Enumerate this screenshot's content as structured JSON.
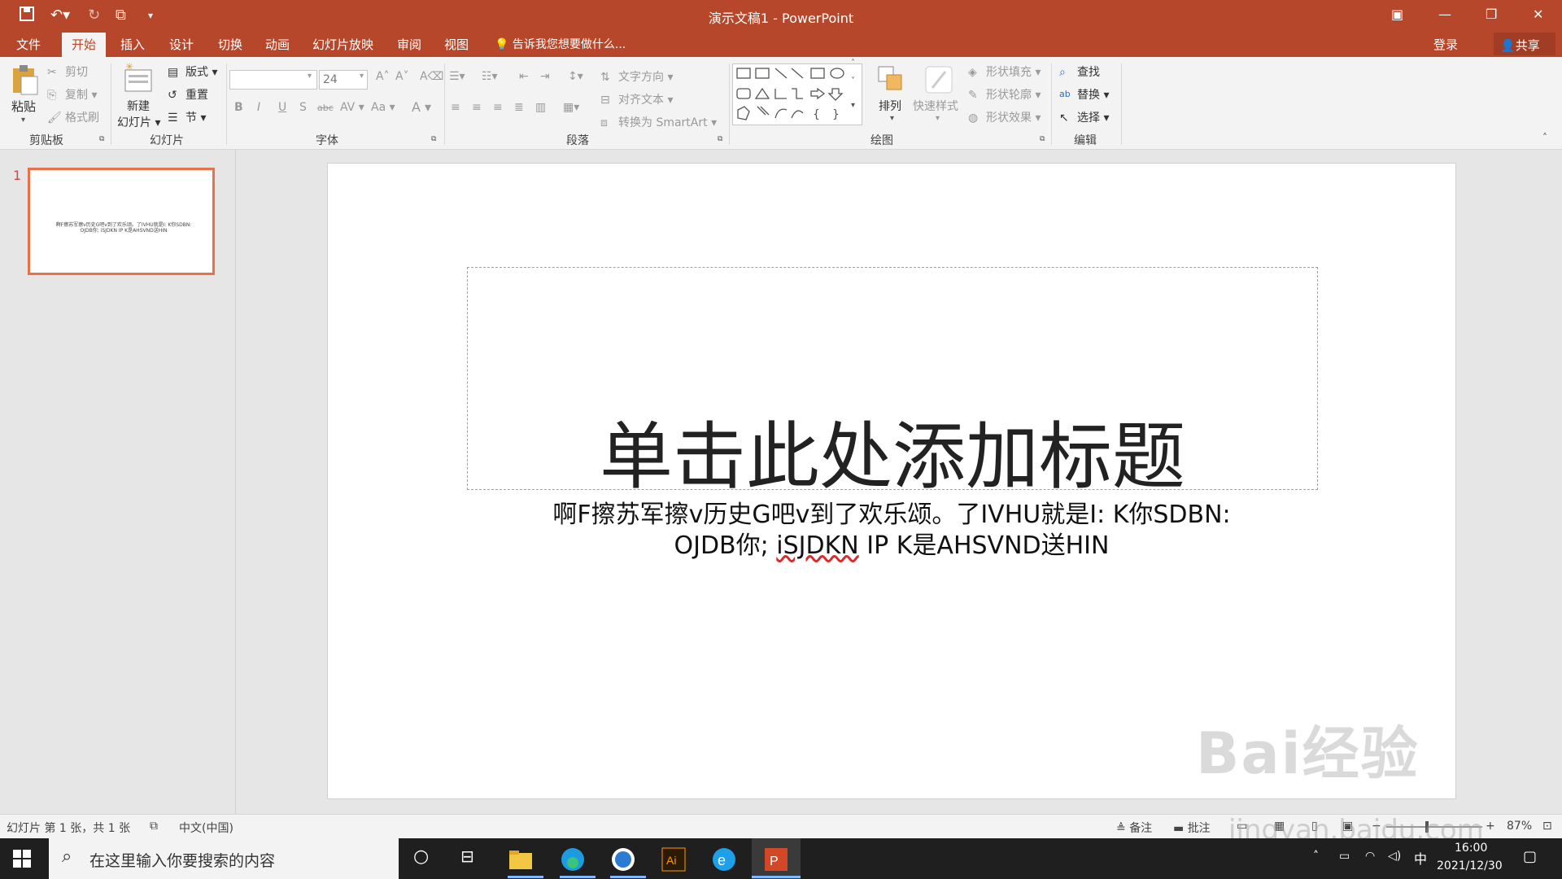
{
  "window": {
    "title": "演示文稿1 - PowerPoint"
  },
  "tabs": [
    {
      "label": "文件"
    },
    {
      "label": "开始"
    },
    {
      "label": "插入"
    },
    {
      "label": "设计"
    },
    {
      "label": "切换"
    },
    {
      "label": "动画"
    },
    {
      "label": "幻灯片放映"
    },
    {
      "label": "审阅"
    },
    {
      "label": "视图"
    }
  ],
  "tellme": "告诉我您想要做什么...",
  "account": {
    "login": "登录",
    "share": "共享"
  },
  "ribbon": {
    "clipboard": {
      "paste": "粘贴",
      "cut": "剪切",
      "copy": "复制",
      "format_painter": "格式刷",
      "label": "剪贴板"
    },
    "slides": {
      "new_slide_1": "新建",
      "new_slide_2": "幻灯片",
      "layout": "版式",
      "reset": "重置",
      "section": "节",
      "label": "幻灯片"
    },
    "font": {
      "size": "24",
      "label": "字体",
      "bold": "B",
      "italic": "I",
      "underline": "U",
      "shadow": "S",
      "strike": "abc",
      "spacing": "AV",
      "case": "Aa",
      "color": "A"
    },
    "paragraph": {
      "text_direction": "文字方向",
      "align_text": "对齐文本",
      "smartart": "转换为 SmartArt",
      "label": "段落"
    },
    "drawing": {
      "arrange": "排列",
      "quick_styles": "快速样式",
      "fill": "形状填充",
      "outline": "形状轮廓",
      "effects": "形状效果",
      "label": "绘图"
    },
    "editing": {
      "find": "查找",
      "replace": "替换",
      "select": "选择",
      "label": "编辑"
    }
  },
  "thumbnail": {
    "number": "1",
    "text": "啊F擦苏军擦v历史G吧v到了欢乐颂。了IVHU就是I: K你SDBN: OJDB你; iSJDKN IP K是AHSVND送HIN"
  },
  "slide": {
    "title": "单击此处添加标题",
    "subtitle_line1": "啊F擦苏军擦v历史G吧v到了欢乐颂。了IVHU就是I:   K你SDBN:",
    "subtitle_line2_pre": "OJDB你;  ",
    "subtitle_line2_err": "iSJDKN",
    "subtitle_line2_post": " IP K是AHSVND送HIN"
  },
  "status": {
    "slide_count": "幻灯片 第 1 张，共 1 张",
    "language": "中文(中国)",
    "notes": "备注",
    "comments": "批注",
    "zoom": "87%"
  },
  "taskbar": {
    "search_placeholder": "在这里输入你要搜索的内容",
    "time": "16:00",
    "date": "2021/12/30",
    "ime": "中"
  },
  "watermark": {
    "brand": "Bai经验",
    "url": "jingyan.baidu.com"
  },
  "colors": {
    "accent": "#b7472a",
    "thumb_border": "#e8704a"
  }
}
